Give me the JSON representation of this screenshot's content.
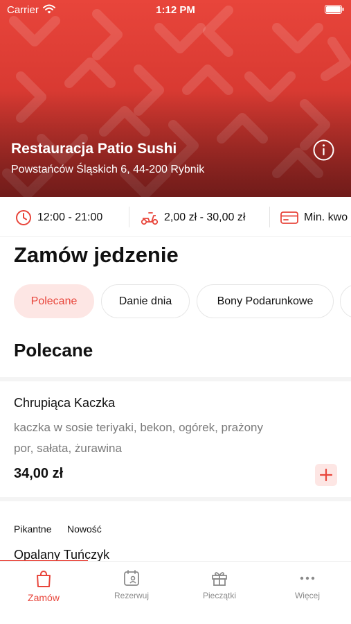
{
  "status_bar": {
    "carrier": "Carrier",
    "time": "1:12 PM"
  },
  "restaurant": {
    "name": "Restauracja Patio Sushi",
    "address": "Powstańców Śląskich 6, 44-200 Rybnik"
  },
  "info_strip": {
    "hours": "12:00 - 21:00",
    "delivery_cost": "2,00 zł - 30,00 zł",
    "min_order_partial": "Min. kwo"
  },
  "order": {
    "title": "Zamów jedzenie",
    "categories": [
      {
        "label": "Polecane",
        "active": true
      },
      {
        "label": "Danie dnia",
        "active": false
      },
      {
        "label": "Bony Podarunkowe",
        "active": false
      }
    ]
  },
  "section": {
    "title": "Polecane",
    "items": [
      {
        "name": "Chrupiąca Kaczka",
        "desc_line1": "kaczka w sosie teriyaki, bekon, ogórek, prażony",
        "desc_line2": "por, sałata, żurawina",
        "price": "34,00 zł"
      },
      {
        "tags": [
          "Pikantne",
          "Nowość"
        ],
        "name": "Opalany Tuńczyk"
      }
    ]
  },
  "tabs": [
    {
      "label": "Zamów",
      "icon": "bag-icon",
      "active": true
    },
    {
      "label": "Rezerwuj",
      "icon": "calendar-person-icon",
      "active": false
    },
    {
      "label": "Pieczątki",
      "icon": "gift-icon",
      "active": false
    },
    {
      "label": "Więcej",
      "icon": "more-dots-icon",
      "active": false
    }
  ],
  "colors": {
    "accent": "#e8453b",
    "accent_soft": "#fde6e4",
    "hero_top": "#e8453b",
    "hero_bottom": "#8c2522"
  }
}
